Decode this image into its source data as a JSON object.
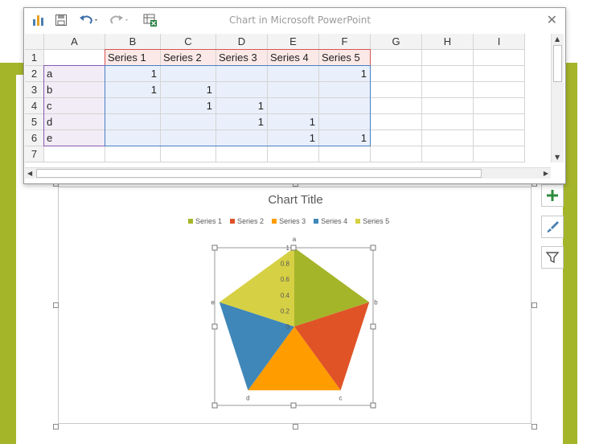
{
  "window": {
    "title": "Chart in Microsoft PowerPoint"
  },
  "columns": [
    "A",
    "B",
    "C",
    "D",
    "E",
    "F",
    "G",
    "H",
    "I"
  ],
  "rows": [
    "1",
    "2",
    "3",
    "4",
    "5",
    "6",
    "7"
  ],
  "sheet": {
    "header": [
      "",
      "Series 1",
      "Series 2",
      "Series 3",
      "Series 4",
      "Series 5"
    ],
    "data": [
      [
        "a",
        "1",
        "",
        "",
        "",
        "1"
      ],
      [
        "b",
        "1",
        "1",
        "",
        "",
        ""
      ],
      [
        "c",
        "",
        "1",
        "1",
        "",
        ""
      ],
      [
        "d",
        "",
        "",
        "1",
        "1",
        ""
      ],
      [
        "e",
        "",
        "",
        "",
        "1",
        "1"
      ]
    ]
  },
  "colors": {
    "series1": "#a5b52a",
    "series2": "#e05327",
    "series3": "#ff9c00",
    "series4": "#3f87b8",
    "series5": "#d6d044",
    "accent": "#a5b52a"
  },
  "chart_data": {
    "type": "radar",
    "title": "Chart Title",
    "categories": [
      "a",
      "b",
      "c",
      "d",
      "e"
    ],
    "series": [
      {
        "name": "Series 1",
        "values": [
          1,
          1,
          0,
          0,
          0
        ]
      },
      {
        "name": "Series 2",
        "values": [
          0,
          1,
          1,
          0,
          0
        ]
      },
      {
        "name": "Series 3",
        "values": [
          0,
          0,
          1,
          1,
          0
        ]
      },
      {
        "name": "Series 4",
        "values": [
          0,
          0,
          0,
          1,
          1
        ]
      },
      {
        "name": "Series 5",
        "values": [
          1,
          0,
          0,
          0,
          1
        ]
      }
    ],
    "axis_ticks": [
      "0",
      "0.2",
      "0.4",
      "0.6",
      "0.8",
      "1"
    ],
    "ylim": [
      0,
      1
    ],
    "legend_position": "top"
  },
  "side_buttons": [
    "chart-elements-icon",
    "chart-styles-icon",
    "chart-filters-icon"
  ]
}
